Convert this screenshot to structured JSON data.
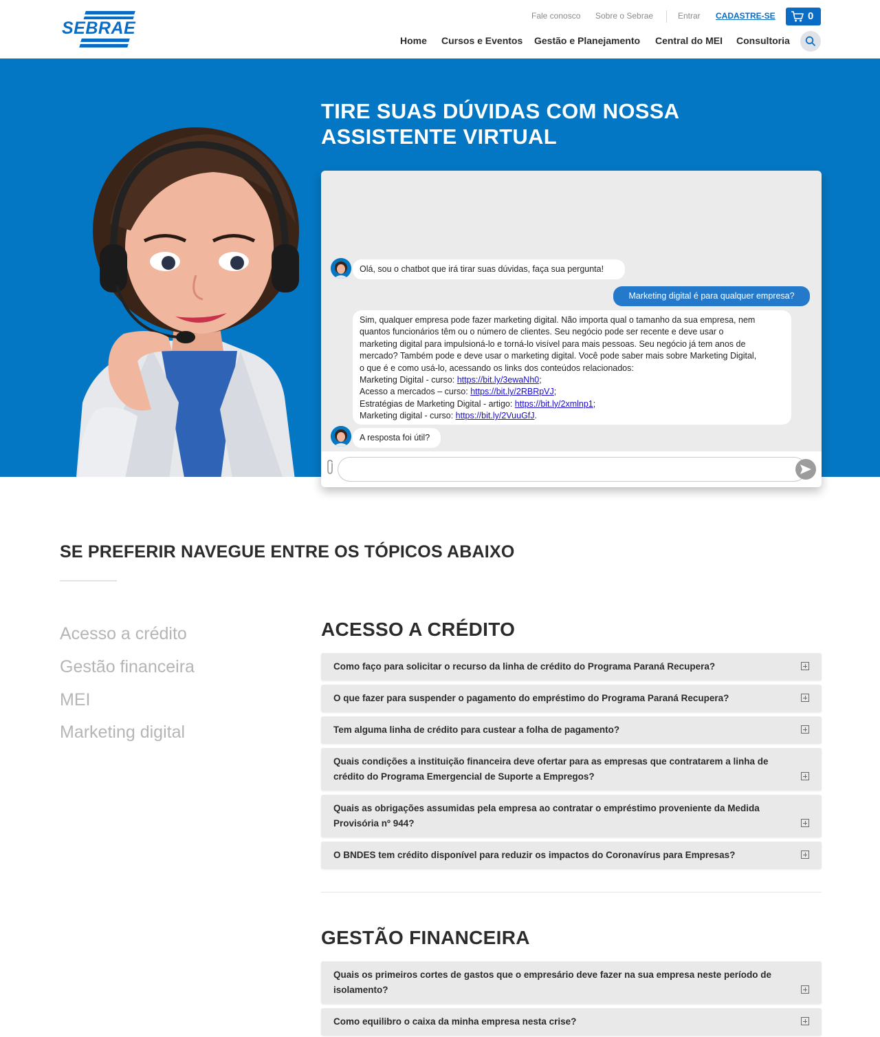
{
  "brand": {
    "logo_text": "SEBRAE",
    "primary_color": "#0477c4",
    "accent_color": "#0a6cc4"
  },
  "header": {
    "util_links": [
      "Fale conosco",
      "Sobre o Sebrae"
    ],
    "login_label": "Entrar",
    "signup_label": "CADASTRE-SE",
    "cart_count": "0",
    "nav": [
      "Home",
      "Cursos e Eventos",
      "Gestão e Planejamento",
      "Central do MEI",
      "Consultoria"
    ],
    "search_icon": "search-icon",
    "cart_icon": "cart-icon"
  },
  "hero": {
    "title_line1": "TIRE SUAS DÚVIDAS COM NOSSA",
    "title_line2": "ASSISTENTE VIRTUAL"
  },
  "chat": {
    "greeting": "Olá, sou o chatbot que irá tirar suas dúvidas, faça sua pergunta!",
    "user_question": "Marketing digital é para qualquer empresa?",
    "answer_lines": [
      "Sim, qualquer empresa pode fazer marketing digital. Não importa qual o tamanho da sua empresa, nem",
      "quantos funcionários têm ou o número de clientes. Seu negócio pode ser recente e deve usar o",
      "marketing digital para impulsioná-lo e torná-lo visível para mais pessoas. Seu negócio já tem anos de",
      "mercado? Também pode e deve usar o marketing digital. Você pode saber mais sobre Marketing Digital,",
      "o que é e como usá-lo, acessando os links dos conteúdos relacionados:"
    ],
    "links": [
      {
        "label": "Marketing Digital - curso: ",
        "url": "https://bit.ly/3ewaNh0",
        "suffix": ";"
      },
      {
        "label": "Acesso a mercados – curso: ",
        "url": "https://bit.ly/2RBRpVJ",
        "suffix": ";"
      },
      {
        "label": "Estratégias de Marketing Digital - artigo: ",
        "url": "https://bit.ly/2xmlnp1",
        "suffix": ";"
      },
      {
        "label": " Marketing digital - curso: ",
        "url": "https://bit.ly/2VuuGfJ",
        "suffix": "."
      }
    ],
    "followup": "A resposta foi útil?",
    "input_placeholder": ""
  },
  "topics": {
    "heading": "SE PREFERIR NAVEGUE ENTRE OS TÓPICOS ABAIXO",
    "sidebar": [
      "Acesso a crédito",
      "Gestão financeira",
      "MEI",
      "Marketing digital"
    ]
  },
  "sections": [
    {
      "title": "ACESSO A CRÉDITO",
      "questions": [
        [
          "Como faço para solicitar o recurso da linha de crédito do Programa Paraná Recupera?"
        ],
        [
          "O que fazer para suspender o pagamento do empréstimo do Programa Paraná Recupera?"
        ],
        [
          "Tem alguma linha de crédito para custear a folha de pagamento?"
        ],
        [
          "Quais condições a instituição financeira deve ofertar para as empresas que contratarem a linha de",
          "crédito do Programa Emergencial de Suporte a Empregos?"
        ],
        [
          "Quais as obrigações assumidas pela empresa ao contratar o empréstimo proveniente da Medida",
          "Provisória nº 944?"
        ],
        [
          "O BNDES tem crédito disponível para reduzir os impactos do Coronavírus para Empresas?"
        ]
      ]
    },
    {
      "title": "GESTÃO FINANCEIRA",
      "questions": [
        [
          "Quais os primeiros cortes de gastos que o empresário deve fazer na sua empresa neste período de",
          "isolamento?"
        ],
        [
          "Como equilibro o caixa da minha empresa nesta crise?"
        ]
      ]
    }
  ]
}
